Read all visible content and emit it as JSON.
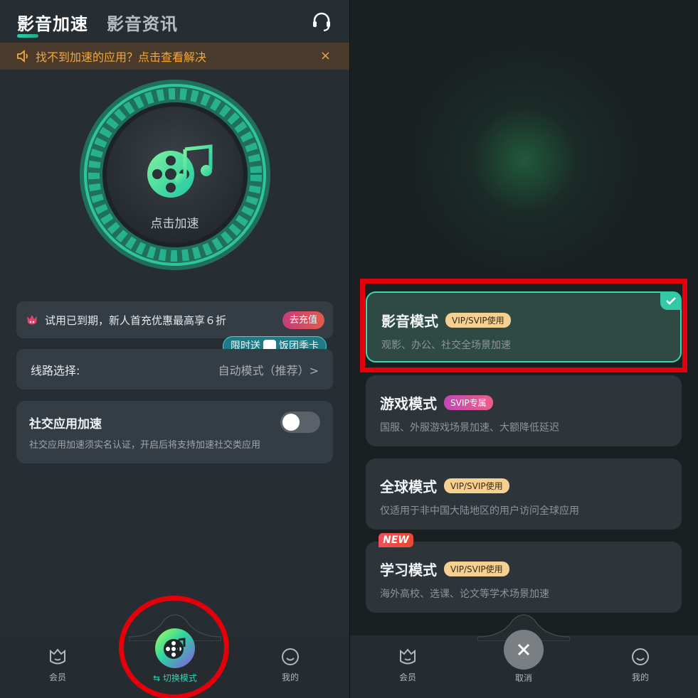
{
  "left": {
    "tabs": [
      "影音加速",
      "影音资讯"
    ],
    "notice": "找不到加速的应用？点击查看解决",
    "notice_close": "×",
    "dial_label": "点击加速",
    "promo": {
      "text": "试用已到期，新人首充优惠最高享６折",
      "button": "去充值"
    },
    "gift": {
      "prefix": "限时送",
      "suffix": "饭团季卡"
    },
    "route": {
      "label": "线路选择:",
      "value": "自动模式（推荐）>"
    },
    "social": {
      "title": "社交应用加速",
      "desc": "社交应用加速须实名认证，开启后将支持加速社交类应用",
      "toggle_on": false
    },
    "bottom": {
      "member": "会员",
      "switch": "⇆ 切换模式",
      "mine": "我的"
    }
  },
  "right": {
    "modes": [
      {
        "title": "影音模式",
        "badge": "VIP/SVIP使用",
        "desc": "观影、办公、社交全场景加速",
        "selected": true
      },
      {
        "title": "游戏模式",
        "badge": "SVIP专属",
        "desc": "国服、外服游戏场景加速、大额降低延迟",
        "selected": false
      },
      {
        "title": "全球模式",
        "badge": "VIP/SVIP使用",
        "desc": "仅适用于非中国大陆地区的用户访问全球应用",
        "selected": false
      },
      {
        "title": "学习模式",
        "badge": "VIP/SVIP使用",
        "desc": "海外高校、选课、论文等学术场景加速",
        "selected": false
      }
    ],
    "new_tag": "NEW",
    "bottom": {
      "member": "会员",
      "cancel": "取消",
      "mine": "我的"
    }
  },
  "colors": {
    "accent": "#35d3b3",
    "highlight_red": "#e3000b",
    "notice_text": "#f2a73a"
  },
  "icons": [
    "headset-icon",
    "speaker-icon",
    "film-music-icon",
    "member-icon",
    "smile-icon",
    "close-icon",
    "check-icon"
  ]
}
